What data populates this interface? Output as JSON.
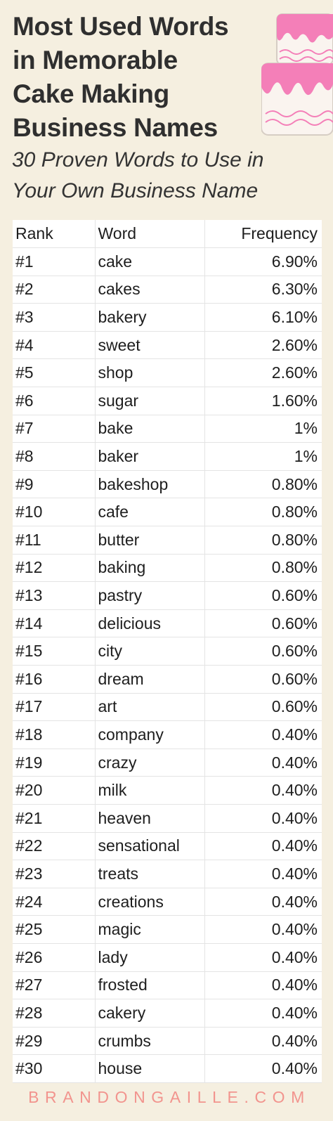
{
  "header": {
    "title_lines": [
      "Most Used Words",
      "in Memorable",
      "Cake Making",
      "Business Names"
    ],
    "subtitle_lines": [
      "30 Proven Words to Use in",
      "Your Own Business Name"
    ]
  },
  "table": {
    "columns": [
      "Rank",
      "Word",
      "Frequency"
    ],
    "rows": [
      {
        "rank": "#1",
        "word": "cake",
        "freq": "6.90%"
      },
      {
        "rank": "#2",
        "word": "cakes",
        "freq": "6.30%"
      },
      {
        "rank": "#3",
        "word": "bakery",
        "freq": "6.10%"
      },
      {
        "rank": "#4",
        "word": "sweet",
        "freq": "2.60%"
      },
      {
        "rank": "#5",
        "word": "shop",
        "freq": "2.60%"
      },
      {
        "rank": "#6",
        "word": "sugar",
        "freq": "1.60%"
      },
      {
        "rank": "#7",
        "word": "bake",
        "freq": "1%"
      },
      {
        "rank": "#8",
        "word": "baker",
        "freq": "1%"
      },
      {
        "rank": "#9",
        "word": "bakeshop",
        "freq": "0.80%"
      },
      {
        "rank": "#10",
        "word": "cafe",
        "freq": "0.80%"
      },
      {
        "rank": "#11",
        "word": "butter",
        "freq": "0.80%"
      },
      {
        "rank": "#12",
        "word": "baking",
        "freq": "0.80%"
      },
      {
        "rank": "#13",
        "word": "pastry",
        "freq": "0.60%"
      },
      {
        "rank": "#14",
        "word": "delicious",
        "freq": "0.60%"
      },
      {
        "rank": "#15",
        "word": "city",
        "freq": "0.60%"
      },
      {
        "rank": "#16",
        "word": "dream",
        "freq": "0.60%"
      },
      {
        "rank": "#17",
        "word": "art",
        "freq": "0.60%"
      },
      {
        "rank": "#18",
        "word": "company",
        "freq": "0.40%"
      },
      {
        "rank": "#19",
        "word": "crazy",
        "freq": "0.40%"
      },
      {
        "rank": "#20",
        "word": "milk",
        "freq": "0.40%"
      },
      {
        "rank": "#21",
        "word": "heaven",
        "freq": "0.40%"
      },
      {
        "rank": "#22",
        "word": "sensational",
        "freq": "0.40%"
      },
      {
        "rank": "#23",
        "word": "treats",
        "freq": "0.40%"
      },
      {
        "rank": "#24",
        "word": "creations",
        "freq": "0.40%"
      },
      {
        "rank": "#25",
        "word": "magic",
        "freq": "0.40%"
      },
      {
        "rank": "#26",
        "word": "lady",
        "freq": "0.40%"
      },
      {
        "rank": "#27",
        "word": "frosted",
        "freq": "0.40%"
      },
      {
        "rank": "#28",
        "word": "cakery",
        "freq": "0.40%"
      },
      {
        "rank": "#29",
        "word": "crumbs",
        "freq": "0.40%"
      },
      {
        "rank": "#30",
        "word": "house",
        "freq": "0.40%"
      }
    ]
  },
  "footer": {
    "text": "BRANDONGAILLE.COM"
  },
  "colors": {
    "background": "#f5efe0",
    "frosting": "#f47fb8",
    "footer_text": "#f2948e",
    "cake_body": "#faf4ef"
  },
  "icons": {
    "cake": "layer-cake-icon"
  }
}
